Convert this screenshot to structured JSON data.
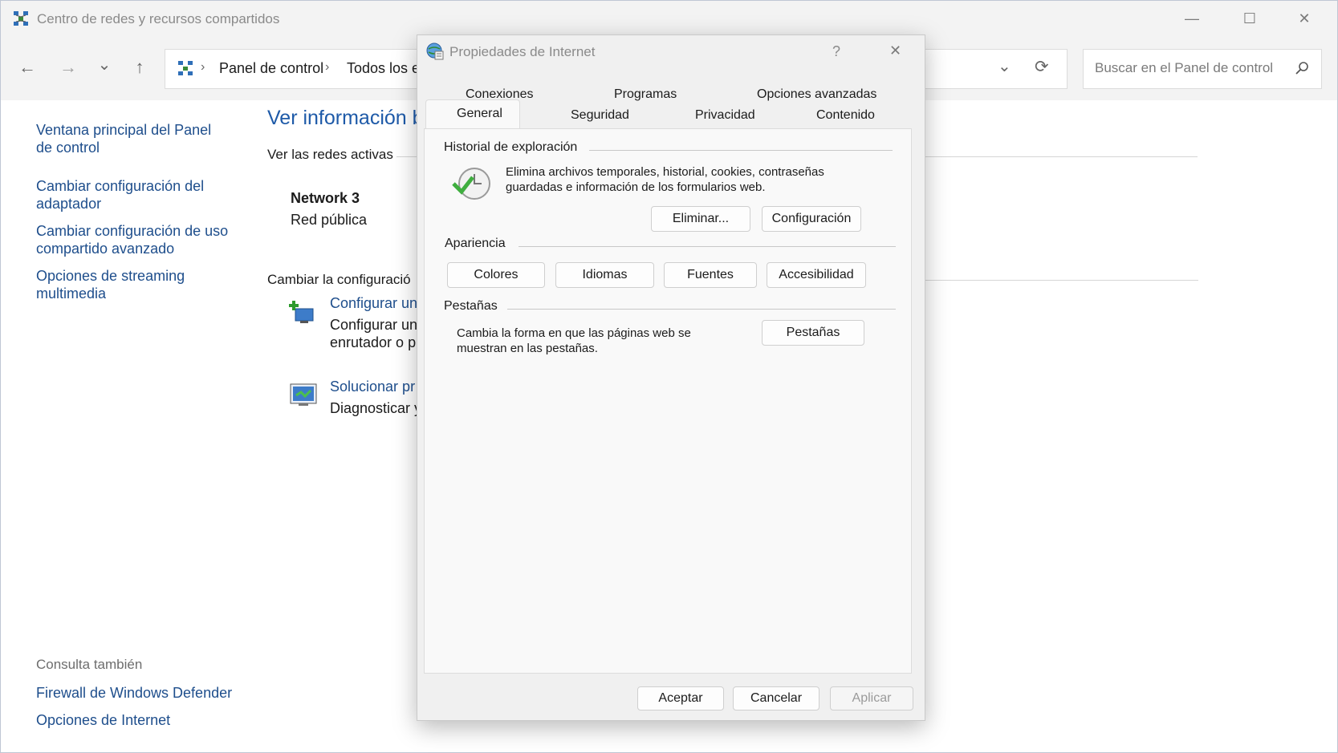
{
  "window": {
    "title": "Centro de redes y recursos compartidos",
    "minimize_glyph": "—",
    "maximize_glyph": "☐",
    "close_glyph": "✕"
  },
  "nav": {
    "back_glyph": "←",
    "forward_glyph": "→",
    "recent_glyph": "⌄",
    "up_glyph": "↑",
    "breadcrumb": [
      "Panel de control",
      "Todos los e"
    ],
    "breadcrumb_sep": "›",
    "refresh_glyph": "⟳",
    "dropdown_glyph": "⌄",
    "search_placeholder": "Buscar en el Panel de control"
  },
  "sidebar": {
    "links": [
      "Ventana principal del Panel de control",
      "Cambiar configuración del adaptador",
      "Cambiar configuración de uso compartido avanzado",
      "Opciones de streaming multimedia"
    ],
    "see_also_title": "Consulta también",
    "see_also": [
      "Firewall de Windows Defender",
      "Opciones de Internet"
    ]
  },
  "content": {
    "heading": "Ver información b",
    "active_networks_label": "Ver las redes activas",
    "network_name": "Network 3",
    "network_type": "Red pública",
    "change_settings_label": "Cambiar la configuració",
    "task1_link": "Configurar un",
    "task1_desc": [
      "Configurar un",
      "enrutador o p"
    ],
    "task2_link": "Solucionar pr",
    "task2_desc": "Diagnosticar y"
  },
  "dialog": {
    "title": "Propiedades de Internet",
    "help_glyph": "?",
    "close_glyph": "✕",
    "tabs_row1": [
      "Conexiones",
      "Programas",
      "Opciones avanzadas"
    ],
    "tabs_row2": [
      "General",
      "Seguridad",
      "Privacidad",
      "Contenido"
    ],
    "active_tab": "General",
    "history": {
      "title": "Historial de exploración",
      "desc_line1": "Elimina archivos temporales, historial, cookies, contraseñas",
      "desc_line2": "guardadas e información de los formularios web.",
      "delete_button": "Eliminar...",
      "settings_button": "Configuración"
    },
    "appearance": {
      "title": "Apariencia",
      "buttons": [
        "Colores",
        "Idiomas",
        "Fuentes",
        "Accesibilidad"
      ]
    },
    "tabs_group": {
      "title": "Pestañas",
      "desc_line1": "Cambia la forma en que las páginas web se",
      "desc_line2": "muestran en las pestañas.",
      "button": "Pestañas"
    },
    "footer": {
      "ok": "Aceptar",
      "cancel": "Cancelar",
      "apply": "Aplicar"
    }
  },
  "colors": {
    "link": "#1e4e8c",
    "heading": "#1e5aa8",
    "titlebar": "#f3f3f3",
    "dialog_bg": "#f0f0f0"
  }
}
